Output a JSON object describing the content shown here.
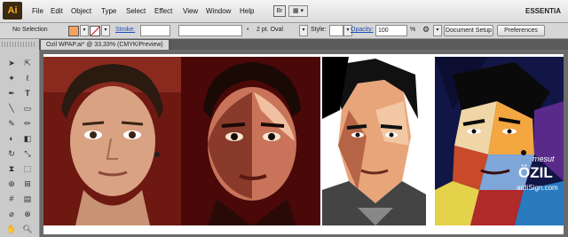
{
  "app": {
    "logo": "Ai",
    "workspace": "ESSENTIA"
  },
  "menu": [
    "File",
    "Edit",
    "Object",
    "Type",
    "Select",
    "Effect",
    "View",
    "Window",
    "Help"
  ],
  "menubar_icons": {
    "bridge": "Br",
    "arrange": "▦ ▾"
  },
  "control": {
    "selection": "No Selection",
    "stroke_label": "Stroke:",
    "brush_value": "2 pt. Oval",
    "style_label": "Style:",
    "opacity_label": "Opacity:",
    "opacity_value": "100",
    "opacity_unit": "%",
    "document_setup": "Document Setup",
    "preferences": "Preferences"
  },
  "document_tab": "Ozil WPAP.ai* @ 33,33% (CMYK/Preview)",
  "artwork": {
    "portrait4_text": {
      "line1": "mesut",
      "line2": "ÖZIL",
      "line3": "ardiSign.com"
    }
  },
  "colors": {
    "fill_swatch": "#f3a25f",
    "accent": "#1f4fb7"
  }
}
